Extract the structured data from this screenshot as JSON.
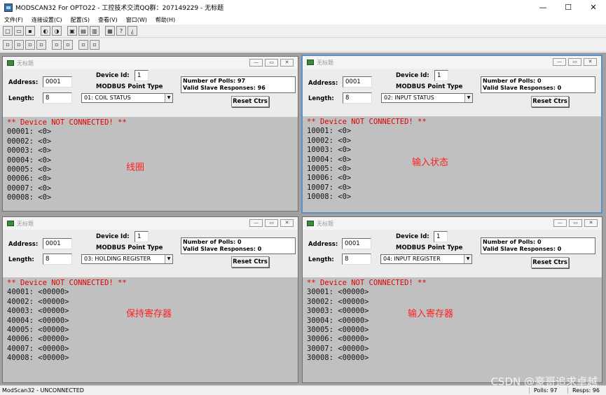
{
  "app": {
    "title": "MODSCAN32 For OPTO22 - 工控技术交流QQ群：207149229 - 无标题"
  },
  "menu": [
    "文件(F)",
    "连接设置(C)",
    "配置(S)",
    "查看(V)",
    "窗口(W)",
    "帮助(H)"
  ],
  "windows": [
    {
      "title": "无标题",
      "address": "0001",
      "length": "8",
      "device_id": "1",
      "point_type": "01: COIL STATUS",
      "polls": "Number of Polls: 97",
      "responses": "Valid Slave Responses: 96",
      "err": "** Device NOT CONNECTED! **",
      "rows": [
        "00001: <0>",
        "00002: <0>",
        "00003: <0>",
        "00004: <0>",
        "00005: <0>",
        "00006: <0>",
        "00007: <0>",
        "00008: <0>"
      ],
      "overlay": "线圈"
    },
    {
      "title": "无标题",
      "address": "0001",
      "length": "8",
      "device_id": "1",
      "point_type": "02: INPUT STATUS",
      "polls": "Number of Polls: 0",
      "responses": "Valid Slave Responses: 0",
      "err": "** Device NOT CONNECTED! **",
      "rows": [
        "10001: <0>",
        "10002: <0>",
        "10003: <0>",
        "10004: <0>",
        "10005: <0>",
        "10006: <0>",
        "10007: <0>",
        "10008: <0>"
      ],
      "overlay": "输入状态"
    },
    {
      "title": "无标题",
      "address": "0001",
      "length": "8",
      "device_id": "1",
      "point_type": "03: HOLDING REGISTER",
      "polls": "Number of Polls: 0",
      "responses": "Valid Slave Responses: 0",
      "err": "** Device NOT CONNECTED! **",
      "rows": [
        "40001: <00000>",
        "40002: <00000>",
        "40003: <00000>",
        "40004: <00000>",
        "40005: <00000>",
        "40006: <00000>",
        "40007: <00000>",
        "40008: <00000>"
      ],
      "overlay": "保持寄存器"
    },
    {
      "title": "无标题",
      "address": "0001",
      "length": "8",
      "device_id": "1",
      "point_type": "04: INPUT REGISTER",
      "polls": "Number of Polls: 0",
      "responses": "Valid Slave Responses: 0",
      "err": "** Device NOT CONNECTED! **",
      "rows": [
        "30001: <00000>",
        "30002: <00000>",
        "30003: <00000>",
        "30004: <00000>",
        "30005: <00000>",
        "30006: <00000>",
        "30007: <00000>",
        "30008: <00000>"
      ],
      "overlay": "输入寄存器"
    }
  ],
  "labels": {
    "address": "Address:",
    "length": "Length:",
    "device_id": "Device Id:",
    "point_type": "MODBUS Point Type",
    "reset": "Reset Ctrs"
  },
  "status": {
    "left": "ModScan32 - UNCONNECTED",
    "polls": "Polls: 97",
    "resps": "Resps: 96"
  },
  "watermark": "CSDN @豪哥追求卓越",
  "icons": [
    "new-icon",
    "open-icon",
    "save-icon",
    "connect-icon",
    "disconnect-icon",
    "display-icon",
    "config-icon",
    "print-icon",
    "help-icon",
    "about-icon"
  ]
}
